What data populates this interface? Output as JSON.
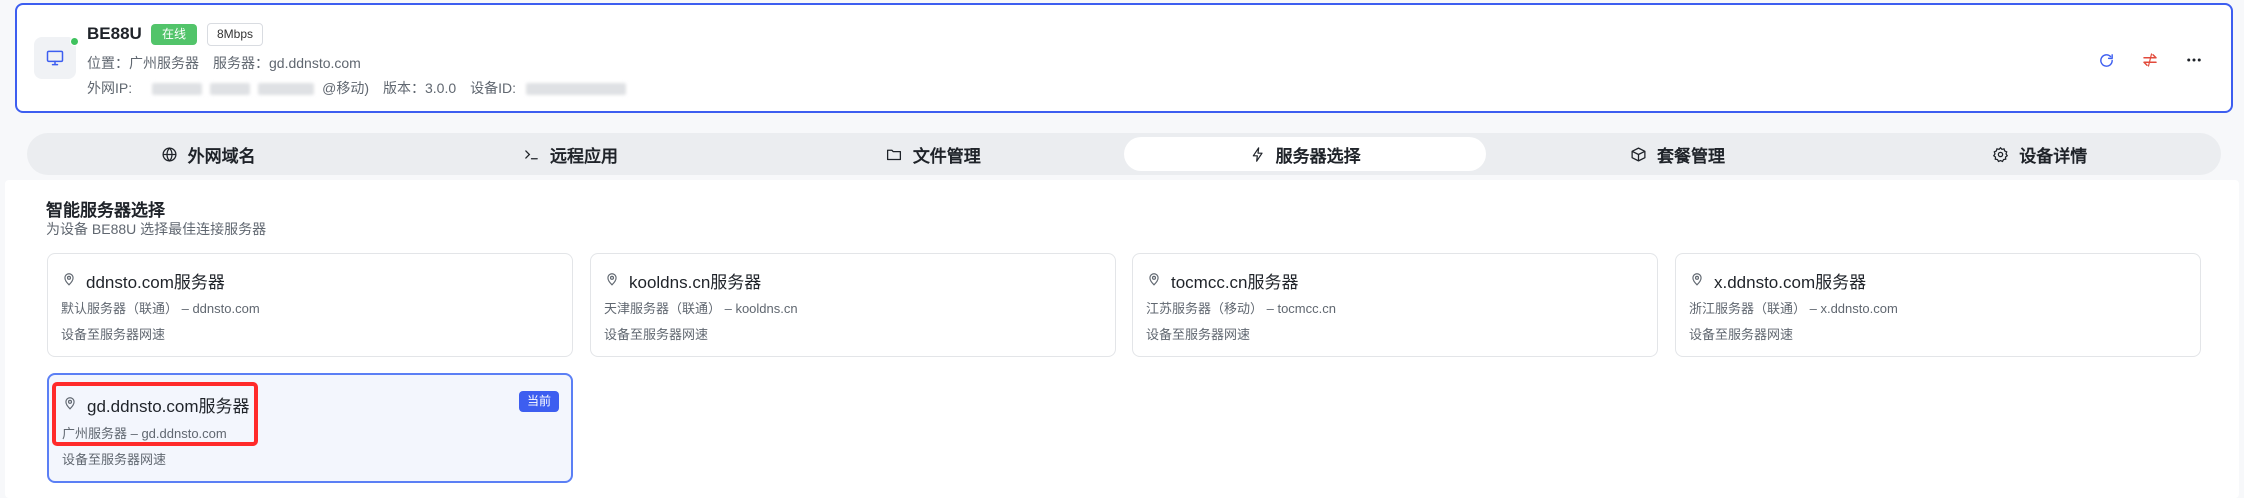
{
  "device": {
    "name": "BE88U",
    "status": "在线",
    "speed": "8Mbps",
    "location_label": "位置：",
    "location": "广州服务器",
    "server_label": "服务器：",
    "server": "gd.ddnsto.com",
    "ip_label": "外网IP:",
    "ip_suffix": "@移动)",
    "version_label": "版本：",
    "version": "3.0.0",
    "device_id_label": "设备ID:",
    "status_color": "#52c46a",
    "online_dot_color": "#3fc25e"
  },
  "actions": {
    "refresh_icon": "refresh-icon",
    "transfer_icon": "transfer-icon",
    "more_icon": "more-icon"
  },
  "tabs": [
    {
      "label": "外网域名",
      "icon": "globe-icon"
    },
    {
      "label": "远程应用",
      "icon": "terminal-icon"
    },
    {
      "label": "文件管理",
      "icon": "folder-icon"
    },
    {
      "label": "服务器选择",
      "icon": "bolt-icon",
      "active": true
    },
    {
      "label": "套餐管理",
      "icon": "box-icon"
    },
    {
      "label": "设备详情",
      "icon": "gear-icon"
    }
  ],
  "section": {
    "title": "智能服务器选择",
    "subtitle": "为设备 BE88U 选择最佳连接服务器"
  },
  "servers": [
    {
      "name": "ddnsto.com服务器",
      "region": "默认服务器（联通） – ddnsto.com",
      "speed": "设备至服务器网速"
    },
    {
      "name": "kooldns.cn服务器",
      "region": "天津服务器（联通） – kooldns.cn",
      "speed": "设备至服务器网速"
    },
    {
      "name": "tocmcc.cn服务器",
      "region": "江苏服务器（移动） – tocmcc.cn",
      "speed": "设备至服务器网速"
    },
    {
      "name": "x.ddnsto.com服务器",
      "region": "浙江服务器（联通） – x.ddnsto.com",
      "speed": "设备至服务器网速"
    },
    {
      "name": "gd.ddnsto.com服务器",
      "region": "广州服务器 – gd.ddnsto.com",
      "speed": "设备至服务器网速",
      "current": true,
      "current_label": "当前"
    }
  ],
  "colors": {
    "accent": "#3d5ef0",
    "highlight": "#ff2a2a"
  }
}
